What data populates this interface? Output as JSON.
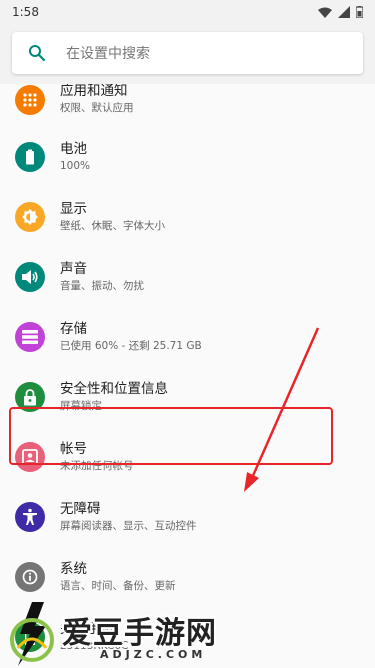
{
  "status_bar": {
    "time": "1:58"
  },
  "search": {
    "placeholder": "在设置中搜索"
  },
  "items": [
    {
      "title": "应用和通知",
      "subtitle": "权限、默认应用",
      "icon": "apps-grid-icon",
      "color": "#f57c00"
    },
    {
      "title": "电池",
      "subtitle": "100%",
      "icon": "battery-icon",
      "color": "#00897b"
    },
    {
      "title": "显示",
      "subtitle": "壁纸、休眠、字体大小",
      "icon": "brightness-icon",
      "color": "#f9a825"
    },
    {
      "title": "声音",
      "subtitle": "音量、振动、勿扰",
      "icon": "volume-icon",
      "color": "#00897b"
    },
    {
      "title": "存储",
      "subtitle": "已使用 60% - 还剩 25.71 GB",
      "icon": "storage-icon",
      "color": "#c142d6"
    },
    {
      "title": "安全性和位置信息",
      "subtitle": "屏幕锁定",
      "icon": "lock-icon",
      "color": "#1e8e3e"
    },
    {
      "title": "帐号",
      "subtitle": "未添加任何帐号",
      "icon": "account-icon",
      "color": "#e8607a"
    },
    {
      "title": "无障碍",
      "subtitle": "屏幕阅读器、显示、互动控件",
      "icon": "accessibility-icon",
      "color": "#3f2ba8"
    },
    {
      "title": "系统",
      "subtitle": "语言、时间、备份、更新",
      "icon": "info-icon",
      "color": "#757575"
    },
    {
      "title": "关于手机",
      "subtitle": "23113RKC6C",
      "icon": "phone-icon",
      "color": "#1e8e3e"
    }
  ],
  "watermark": {
    "text": "爱豆手游网",
    "sub": "ADJZC.COM"
  },
  "colors": {
    "highlight": "#e8262a",
    "accent": "#00897b"
  }
}
